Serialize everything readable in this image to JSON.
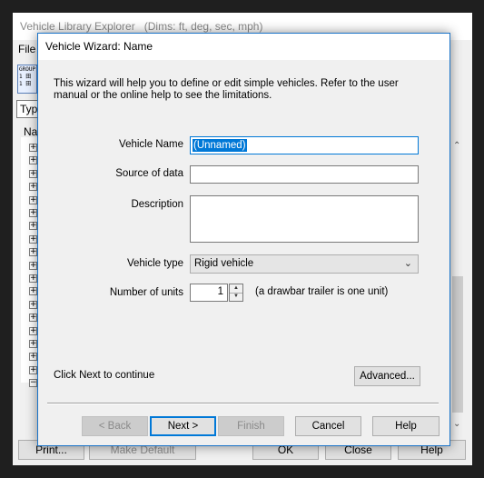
{
  "background_window": {
    "title": "Vehicle Library Explorer",
    "subtitle": "(Dims: ft, deg, sec, mph)",
    "menu_file": "File",
    "toolbar_icon_lines": [
      "GROUP",
      "1 田",
      "1 田"
    ],
    "combo_value": "Typ",
    "tree_header": "Na",
    "tree_expanders": 19,
    "buttons": {
      "print": "Print...",
      "make_default": "Make Default",
      "ok": "OK",
      "close": "Close",
      "help": "Help"
    }
  },
  "dialog": {
    "title": "Vehicle Wizard: Name",
    "intro": "This wizard will help you to define or edit simple vehicles.  Refer to the user manual or the online help to see the limitations.",
    "fields": {
      "vehicle_name_label": "Vehicle Name",
      "vehicle_name_value": "(Unnamed)",
      "source_label": "Source of data",
      "source_value": "",
      "description_label": "Description",
      "description_value": "",
      "vehicle_type_label": "Vehicle type",
      "vehicle_type_value": "Rigid vehicle",
      "units_label": "Number of units",
      "units_value": "1",
      "units_note": "(a drawbar trailer is one unit)"
    },
    "click_next": "Click Next to continue",
    "buttons": {
      "advanced": "Advanced...",
      "back": "< Back",
      "next": "Next >",
      "finish": "Finish",
      "cancel": "Cancel",
      "help": "Help"
    }
  },
  "icons": {
    "dropdown_arrow": "chevron-down-icon",
    "spin_up": "arrow-up-icon",
    "spin_down": "arrow-down-icon",
    "tree_expand": "plus-box-icon",
    "tree_collapse": "minus-box-icon"
  },
  "colors": {
    "accent": "#0078d7",
    "dialog_border": "#1a73c8"
  }
}
